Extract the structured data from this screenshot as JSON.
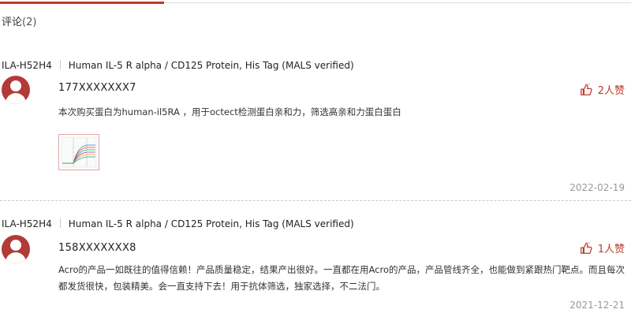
{
  "section": {
    "title": "评论",
    "count": "(2)"
  },
  "reviews": [
    {
      "sku": "ILA-H52H4",
      "product": "Human IL-5 R alpha / CD125 Protein, His Tag (MALS verified)",
      "user": "177XXXXXXX7",
      "likes": "2人赞",
      "content": "本次购买蛋白为human-il5RA ，用于octect检测蛋白亲和力，筛选高亲和力蛋白蛋白",
      "date": "2022-02-19",
      "has_image": true
    },
    {
      "sku": "ILA-H52H4",
      "product": "Human IL-5 R alpha / CD125 Protein, His Tag (MALS verified)",
      "user": "158XXXXXXX8",
      "likes": "1人赞",
      "content": "Acro的产品一如既往的值得信赖！产品质量稳定，结果产出很好。一直都在用Acro的产品，产品管线齐全，也能做到紧跟热门靶点。而且每次都发货很快，包装精美。会一直支持下去！用于抗体筛选，独家选择，不二法门。",
      "date": "2021-12-21",
      "has_image": false
    }
  ],
  "colors": {
    "accent": "#c0392b",
    "avatar": "#b23b37",
    "muted": "#999999"
  },
  "icons": {
    "like": "thumbs-up-icon",
    "avatar": "user-avatar-icon"
  }
}
